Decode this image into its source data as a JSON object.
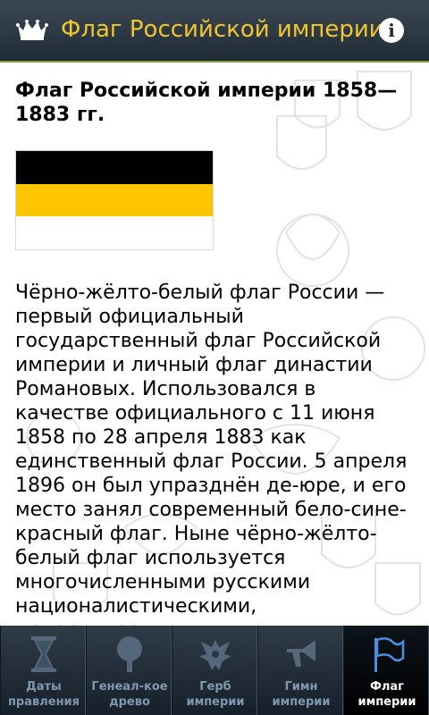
{
  "header": {
    "title": "Флаг Российской империи",
    "info_label": "i"
  },
  "article": {
    "title": "Флаг Российской империи 1858—1883 гг.",
    "flag_colors": [
      "#000000",
      "#fdc400",
      "#ffffff"
    ],
    "body": "Чёрно-жёлто-белый флаг России — первый официальный государственный флаг Российской империи и личный флаг династии Романовых. Использовался в качестве официального с 11 июня 1858 по 28 апреля 1883 как единственный флаг России. 5 апреля 1896 он был упразднён де-юре, и его место занял современный бело-сине-красный флаг. Ныне чёрно-жёлто-белый флаг используется многочисленными русскими националистическими, монархическими и"
  },
  "tabs": [
    {
      "label": "Даты правления",
      "icon": "hourglass-icon",
      "active": false
    },
    {
      "label": "Генеал-кое древо",
      "icon": "tree-icon",
      "active": false
    },
    {
      "label": "Герб империи",
      "icon": "eagle-icon",
      "active": false
    },
    {
      "label": "Гимн империи",
      "icon": "horn-icon",
      "active": false
    },
    {
      "label": "Флаг империи",
      "icon": "flag-icon",
      "active": true
    }
  ],
  "colors": {
    "title_text": "#f1c62c",
    "accent_line": "#7ea44a",
    "tab_label": "#7f98b0",
    "tab_active_label": "#ffffff"
  }
}
